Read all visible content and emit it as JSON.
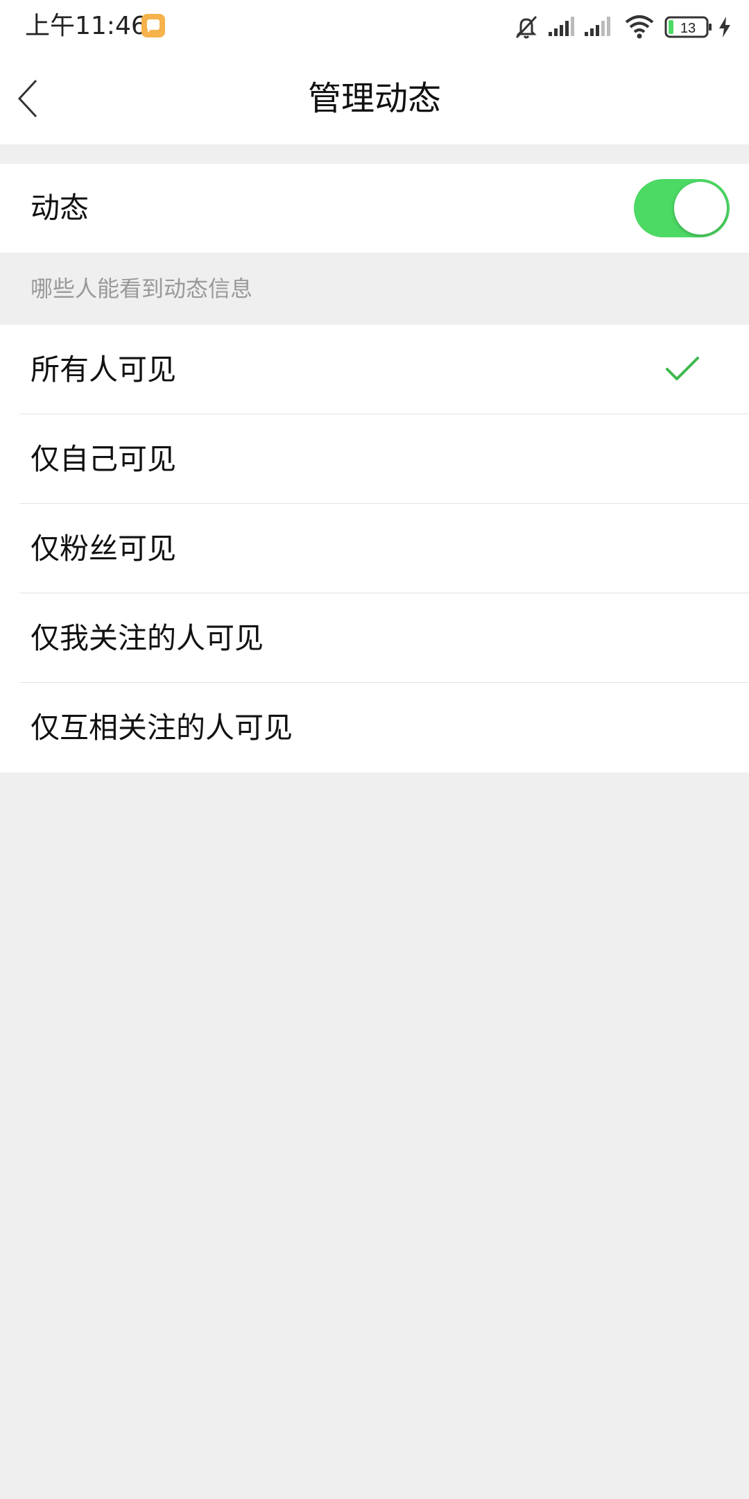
{
  "status_bar": {
    "time": "上午11:46",
    "battery_level": "13",
    "icons": [
      "notification-icon",
      "mute-icon",
      "signal-icon",
      "signal-icon",
      "wifi-icon",
      "battery-icon",
      "charging-icon"
    ]
  },
  "header": {
    "title": "管理动态",
    "back_icon": "back-chevron-icon"
  },
  "dynamic_toggle": {
    "label": "动态",
    "enabled": true,
    "accent_color": "#4cd964"
  },
  "visibility": {
    "section_title": "哪些人能看到动态信息",
    "options": [
      {
        "label": "所有人可见",
        "selected": true
      },
      {
        "label": "仅自己可见",
        "selected": false
      },
      {
        "label": "仅粉丝可见",
        "selected": false
      },
      {
        "label": "仅我关注的人可见",
        "selected": false
      },
      {
        "label": "仅互相关注的人可见",
        "selected": false
      }
    ],
    "check_color": "#3db94e",
    "check_icon": "check-icon"
  }
}
